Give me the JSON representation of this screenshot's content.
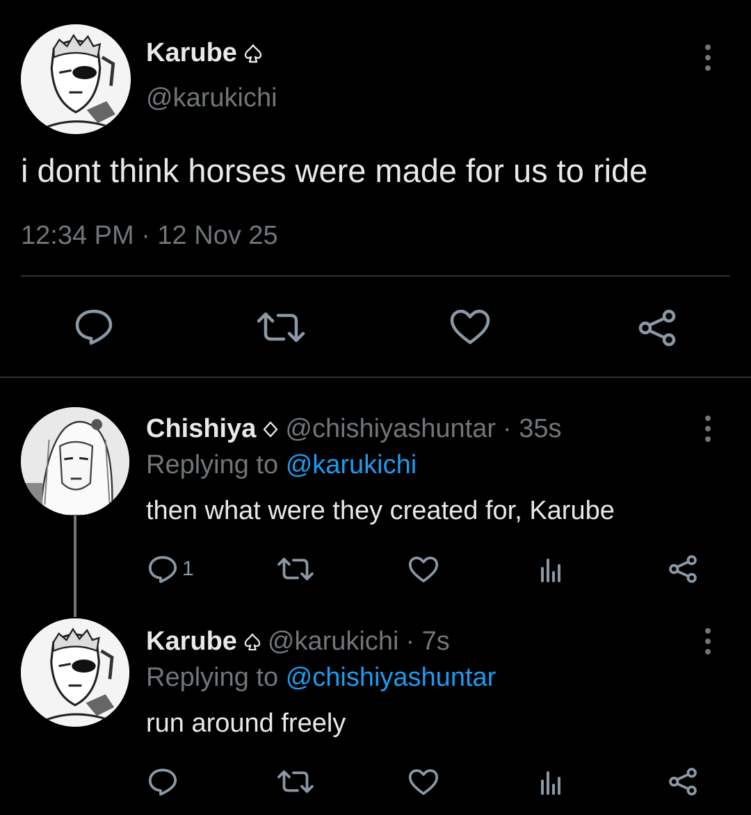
{
  "main_tweet": {
    "display_name": "Karube",
    "badge_icon": "spade-outline-icon",
    "handle": "@karukichi",
    "text": "i dont think horses were made for us to ride",
    "timestamp": "12:34 PM · 12 Nov 25",
    "actions": [
      "reply-icon",
      "retweet-icon",
      "like-icon",
      "share-icon"
    ]
  },
  "replies": [
    {
      "display_name": "Chishiya",
      "badge_icon": "diamond-outline-icon",
      "handle": "@chishiyashuntar",
      "time": "· 35s",
      "replying_prefix": "Replying to",
      "replying_to": "@karukichi",
      "text": "then what were they created for, Karube",
      "reply_count": "1"
    },
    {
      "display_name": "Karube",
      "badge_icon": "spade-outline-icon",
      "handle": "@karukichi",
      "time": "· 7s",
      "replying_prefix": "Replying to",
      "replying_to": "@chishiyashuntar",
      "text": "run around freely",
      "reply_count": ""
    }
  ],
  "colors": {
    "background": "#000000",
    "text": "#e7e9ea",
    "muted": "#71767b",
    "link": "#1d9bf0",
    "divider": "#2f3336"
  }
}
